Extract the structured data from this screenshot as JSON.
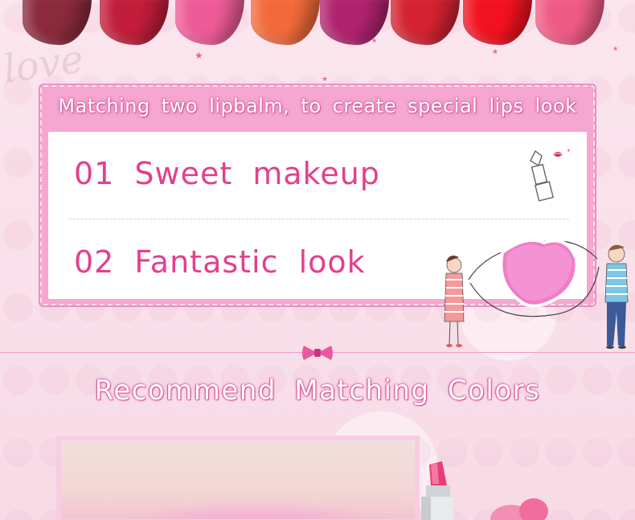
{
  "colors": {
    "accent_pink": "#e43f8e",
    "card_pink": "#f5a7d0",
    "title_outline": "#d7559a"
  },
  "lipstick_row": [
    "#8a2a3c",
    "#c21d3a",
    "#ee5b97",
    "#f26a3a",
    "#b0226e",
    "#d42230",
    "#f2111f",
    "#f05b86"
  ],
  "decor": {
    "script_word": "love"
  },
  "card": {
    "title": "Matching two lipbalm, to create special lips look",
    "items": [
      {
        "label": "01 Sweet makeup",
        "icon": "lipstick-icon"
      },
      {
        "label": "02 Fantastic look",
        "icon": "couple-heart-illustration"
      }
    ]
  },
  "section": {
    "divider_icon": "bow-icon",
    "title": "Recommend Matching Colors"
  }
}
